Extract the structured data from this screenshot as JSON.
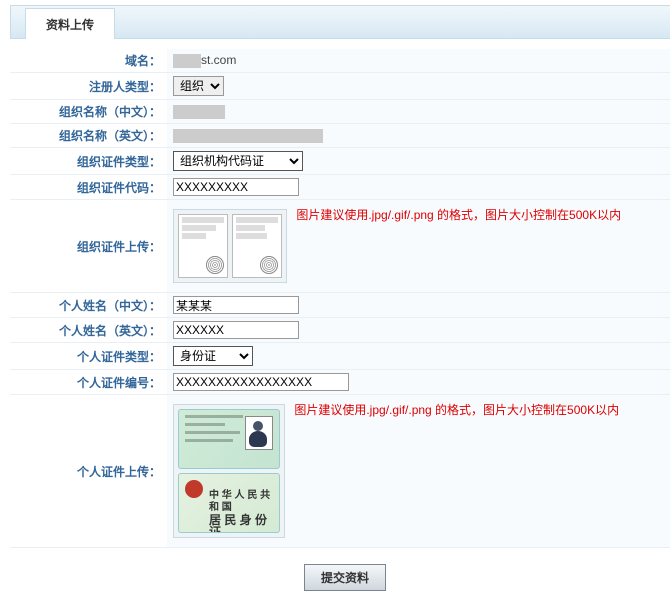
{
  "tab": {
    "title": "资料上传"
  },
  "labels": {
    "domain": "域名：",
    "reg_type": "注册人类型：",
    "org_name_cn": "组织名称（中文）：",
    "org_name_en": "组织名称（英文）：",
    "org_cert_type": "组织证件类型：",
    "org_cert_code": "组织证件代码：",
    "org_cert_upload": "组织证件上传：",
    "person_name_cn": "个人姓名（中文）：",
    "person_name_en": "个人姓名（英文）：",
    "person_cert_type": "个人证件类型：",
    "person_cert_no": "个人证件编号：",
    "person_cert_upload": "个人证件上传："
  },
  "values": {
    "domain_suffix": "st.com",
    "reg_type_option": "组织",
    "org_cert_type_option": "组织机构代码证",
    "org_cert_code": "XXXXXXXXX",
    "person_name_cn": "某某某",
    "person_name_en": "XXXXXX",
    "person_cert_type_option": "身份证",
    "person_cert_no": "XXXXXXXXXXXXXXXXX"
  },
  "hints": {
    "upload": "图片建议使用.jpg/.gif/.png 的格式，图片大小控制在500K以内"
  },
  "id_back": {
    "line1": "中 华 人 民 共 和 国",
    "line2": "居 民 身 份 证"
  },
  "submit": {
    "label": "提交资料"
  }
}
